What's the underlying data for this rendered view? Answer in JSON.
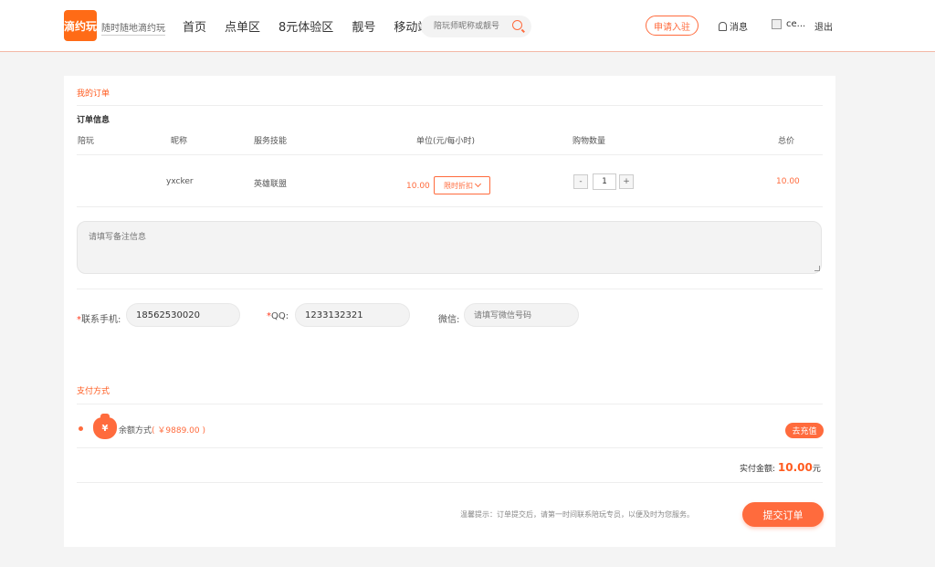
{
  "header": {
    "logo_text": "滴约玩",
    "slogan": "随时随地滴约玩",
    "nav": [
      "首页",
      "点单区",
      "8元体验区",
      "靓号",
      "移动端"
    ],
    "search_placeholder": "陪玩师昵称或靓号",
    "apply_label": "申请入驻",
    "message_label": "消息",
    "user_name": "ce...",
    "logout_label": "退出"
  },
  "order": {
    "section_title": "我的订单",
    "info_title": "订单信息",
    "columns": [
      "陪玩",
      "昵称",
      "服务技能",
      "单位(元/每小时)",
      "购物数量",
      "总价"
    ],
    "row": {
      "nickname": "yxcker",
      "skill": "英雄联盟",
      "unit_price": "10.00",
      "discount_label": "限时折扣",
      "quantity": "1",
      "minus": "-",
      "plus": "+",
      "total": "10.00"
    },
    "remark_placeholder": "请填写备注信息"
  },
  "contact": {
    "phone_required": "*",
    "phone_label": "联系手机:",
    "phone_value": "18562530020",
    "qq_required": "*",
    "qq_label": "QQ:",
    "qq_value": "1233132321",
    "wechat_label": "微信:",
    "wechat_placeholder": "请填写微信号码"
  },
  "payment": {
    "section_title": "支付方式",
    "icon_glyph": "¥",
    "method_label": "余额方式",
    "balance": "( ￥9889.00 )",
    "recharge_label": "去充值",
    "total_label": "实付金额:",
    "total_amount": "10.00",
    "total_unit": "元",
    "tip": "温馨提示：订单提交后，请第一时间联系陪玩专员，以便及时为您服务。",
    "submit_label": "提交订单"
  },
  "colors": {
    "accent": "#ff6b3d",
    "brand": "#ff6b16"
  }
}
